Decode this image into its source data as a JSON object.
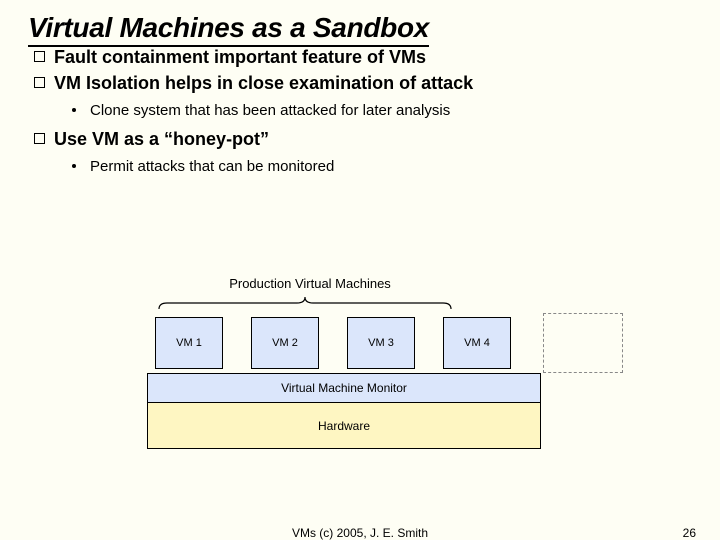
{
  "title": "Virtual Machines as a Sandbox",
  "bullets": {
    "b1": "Fault containment important feature of VMs",
    "b2": "VM Isolation helps in close examination of attack",
    "b2_sub1": "Clone system that has been attacked for later analysis",
    "b3": "Use VM as a “honey-pot”",
    "b3_sub1": "Permit attacks that can be monitored"
  },
  "diagram": {
    "prod_label": "Production Virtual Machines",
    "vms": [
      "VM 1",
      "VM 2",
      "VM 3",
      "VM 4"
    ],
    "vmm": "Virtual Machine Monitor",
    "hardware": "Hardware"
  },
  "footer": {
    "copyright": "VMs (c) 2005, J. E. Smith",
    "page": "26"
  },
  "colors": {
    "bg": "#fefef4",
    "vm_fill": "#dbe6fb",
    "hw_fill": "#fef6c2"
  }
}
